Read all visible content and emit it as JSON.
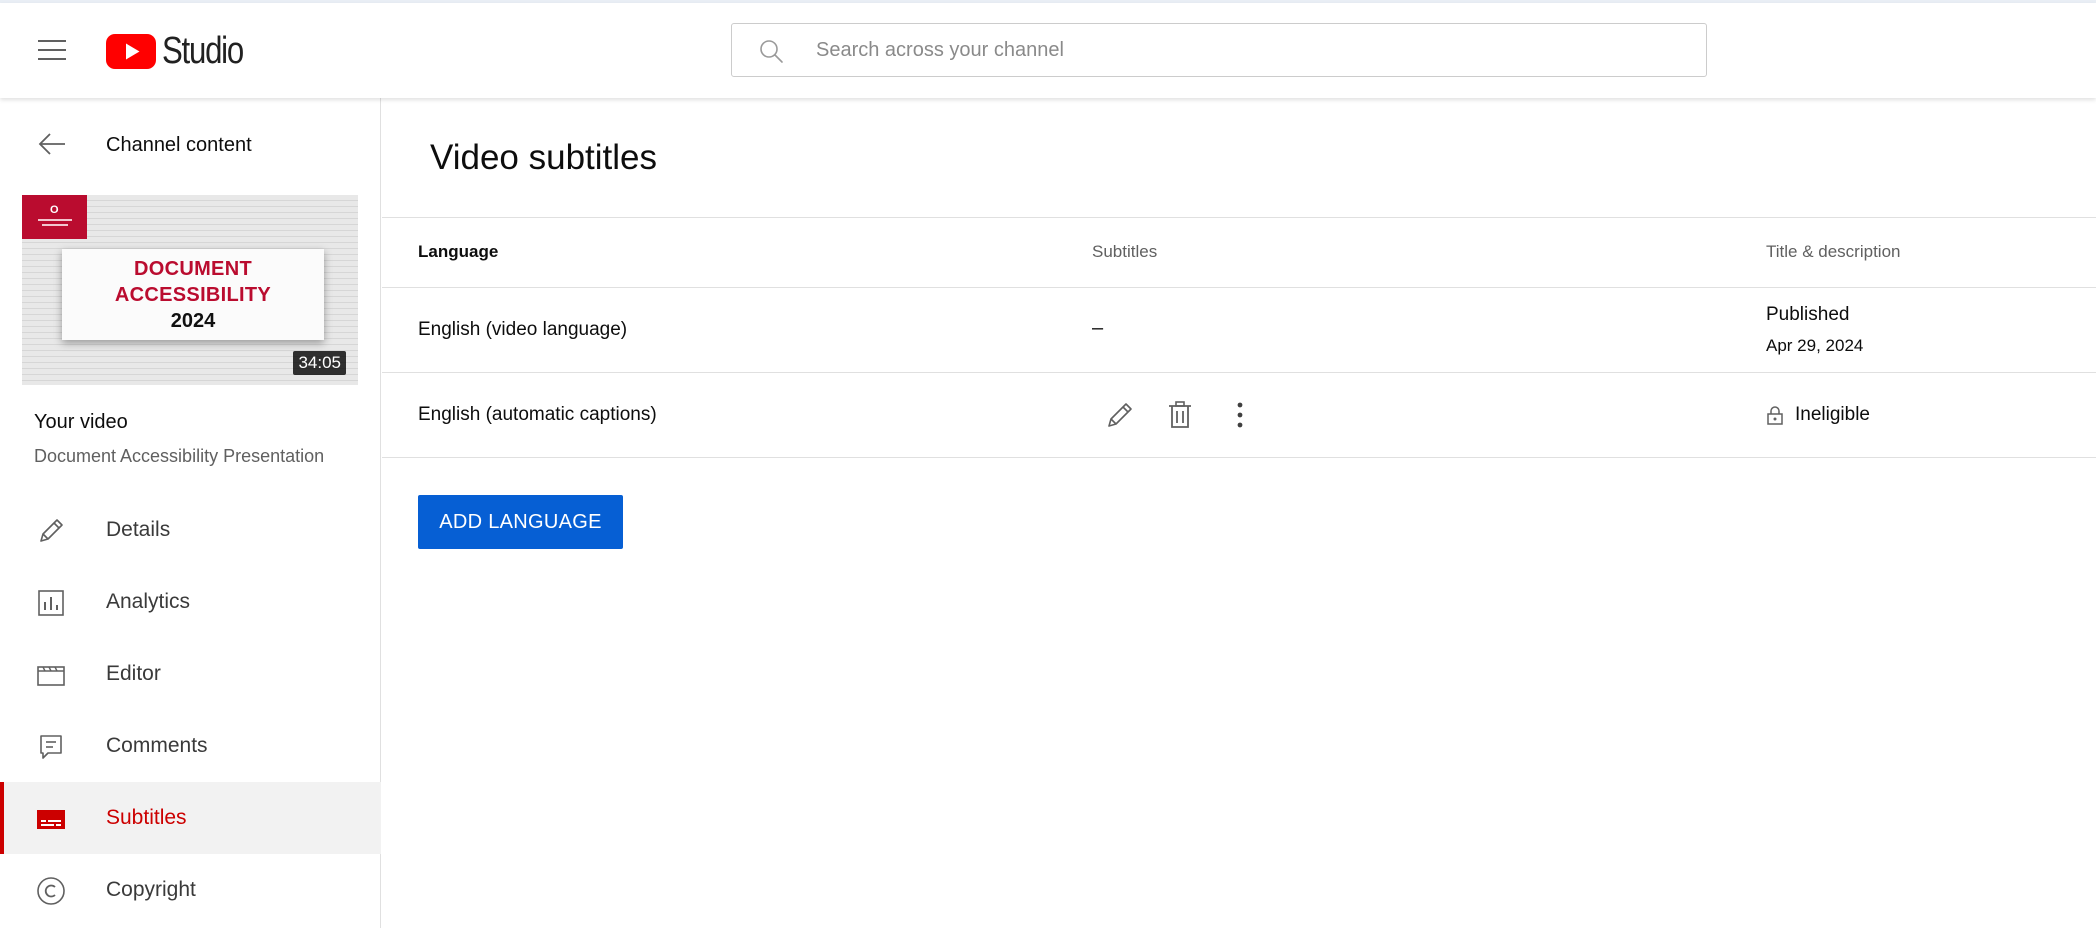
{
  "header": {
    "app_name": "Studio",
    "search": {
      "placeholder": "Search across your channel",
      "value": ""
    }
  },
  "sidebar": {
    "back_label": "Channel content",
    "thumbnail": {
      "line1": "DOCUMENT",
      "line2": "ACCESSIBILITY",
      "line3": "2024",
      "duration": "34:05"
    },
    "your_video_label": "Your video",
    "video_title": "Document Accessibility Presentation",
    "items": [
      {
        "label": "Details",
        "icon": "pencil-icon"
      },
      {
        "label": "Analytics",
        "icon": "analytics-icon"
      },
      {
        "label": "Editor",
        "icon": "editor-icon"
      },
      {
        "label": "Comments",
        "icon": "comments-icon"
      },
      {
        "label": "Subtitles",
        "icon": "subtitles-icon",
        "active": true
      },
      {
        "label": "Copyright",
        "icon": "copyright-icon"
      }
    ]
  },
  "main": {
    "title": "Video subtitles",
    "columns": {
      "language": "Language",
      "subtitles": "Subtitles",
      "title_description": "Title & description"
    },
    "rows": [
      {
        "language": "English (video language)",
        "subtitles": "–",
        "status": "Published",
        "date": "Apr 29, 2024"
      },
      {
        "language": "English (automatic captions)",
        "status": "Ineligible"
      }
    ],
    "add_button_label": "ADD LANGUAGE"
  },
  "colors": {
    "accent_red": "#cc0000",
    "button_blue": "#065fd4",
    "youtube_red": "#ff0000"
  }
}
